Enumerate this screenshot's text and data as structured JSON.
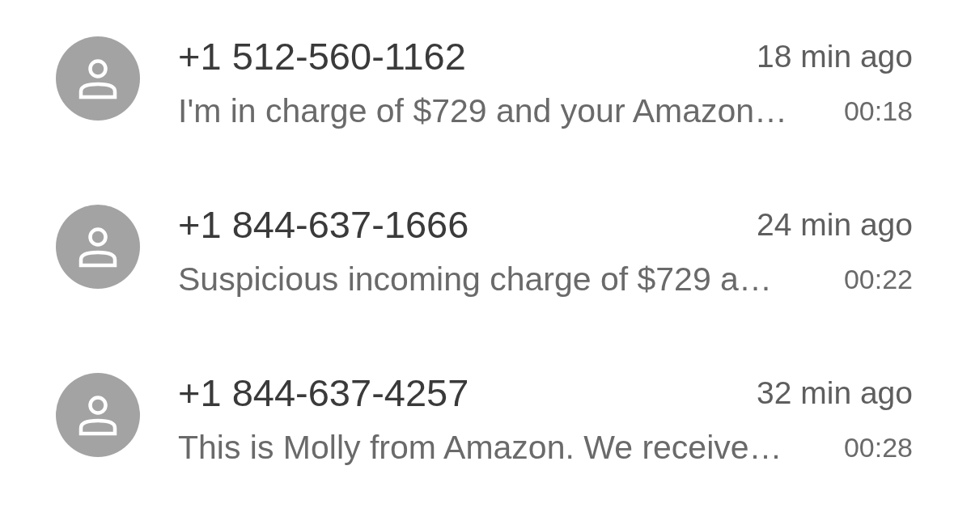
{
  "calls": [
    {
      "number": "+1 512-560-1162",
      "time": "18 min ago",
      "preview": "I'm in charge of $729 and your Amazon…",
      "duration": "00:18"
    },
    {
      "number": "+1 844-637-1666",
      "time": "24 min ago",
      "preview": "Suspicious incoming charge of $729 a…",
      "duration": "00:22"
    },
    {
      "number": "+1 844-637-4257",
      "time": "32 min ago",
      "preview": "This is Molly from Amazon. We receive…",
      "duration": "00:28"
    }
  ]
}
